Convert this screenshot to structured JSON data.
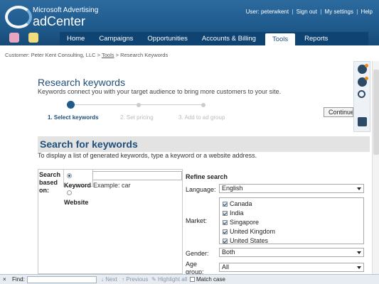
{
  "header": {
    "brand_line1": "Microsoft Advertising",
    "brand_line2": "adCenter",
    "user_links": [
      "User: peterwkent",
      "Sign out",
      "My settings",
      "Help"
    ],
    "separator": "|"
  },
  "nav": {
    "tabs": [
      {
        "label": "Home",
        "active": false
      },
      {
        "label": "Campaigns",
        "active": false
      },
      {
        "label": "Opportunities",
        "active": false
      },
      {
        "label": "Accounts & Billing",
        "active": false
      },
      {
        "label": "Tools",
        "active": true
      },
      {
        "label": "Reports",
        "active": false
      }
    ]
  },
  "breadcrumb": {
    "prefix": "Customer: Peter Kent Consulting, LLC",
    "sep": ">",
    "link": "Tools",
    "current": "Research Keywords"
  },
  "page": {
    "title": "Research keywords",
    "subtitle": "Keywords connect you with your target audience to bring more customers to your site."
  },
  "wizard": {
    "steps": [
      {
        "label": "1. Select keywords",
        "active": true
      },
      {
        "label": "2. Set pricing",
        "active": false
      },
      {
        "label": "3. Add to ad group",
        "active": false
      }
    ],
    "continue_label": "Continue"
  },
  "search_section": {
    "title": "Search for keywords",
    "description": "To display a list of generated keywords, type a keyword or a website address.",
    "search_based_on_label": "Search based on:",
    "keyword_option": "Keyword",
    "keyword_example": "Example: car",
    "website_option": "Website",
    "keyword_value": ""
  },
  "refine": {
    "title": "Refine search",
    "language_label": "Language:",
    "language_value": "English",
    "market_label": "Market:",
    "markets": [
      "Canada",
      "India",
      "Singapore",
      "United Kingdom",
      "United States"
    ],
    "gender_label": "Gender:",
    "gender_value": "Both",
    "age_label": "Age group:",
    "age_value": "All"
  },
  "find_bar": {
    "close": "×",
    "label": "Find:",
    "value": "",
    "next": "Next",
    "previous": "Previous",
    "highlight": "Highlight all",
    "match_case": "Match case"
  },
  "colors": {
    "header_blue": "#1f5a8c",
    "nav_dark": "#0e4372",
    "title_blue": "#1f4e79"
  }
}
